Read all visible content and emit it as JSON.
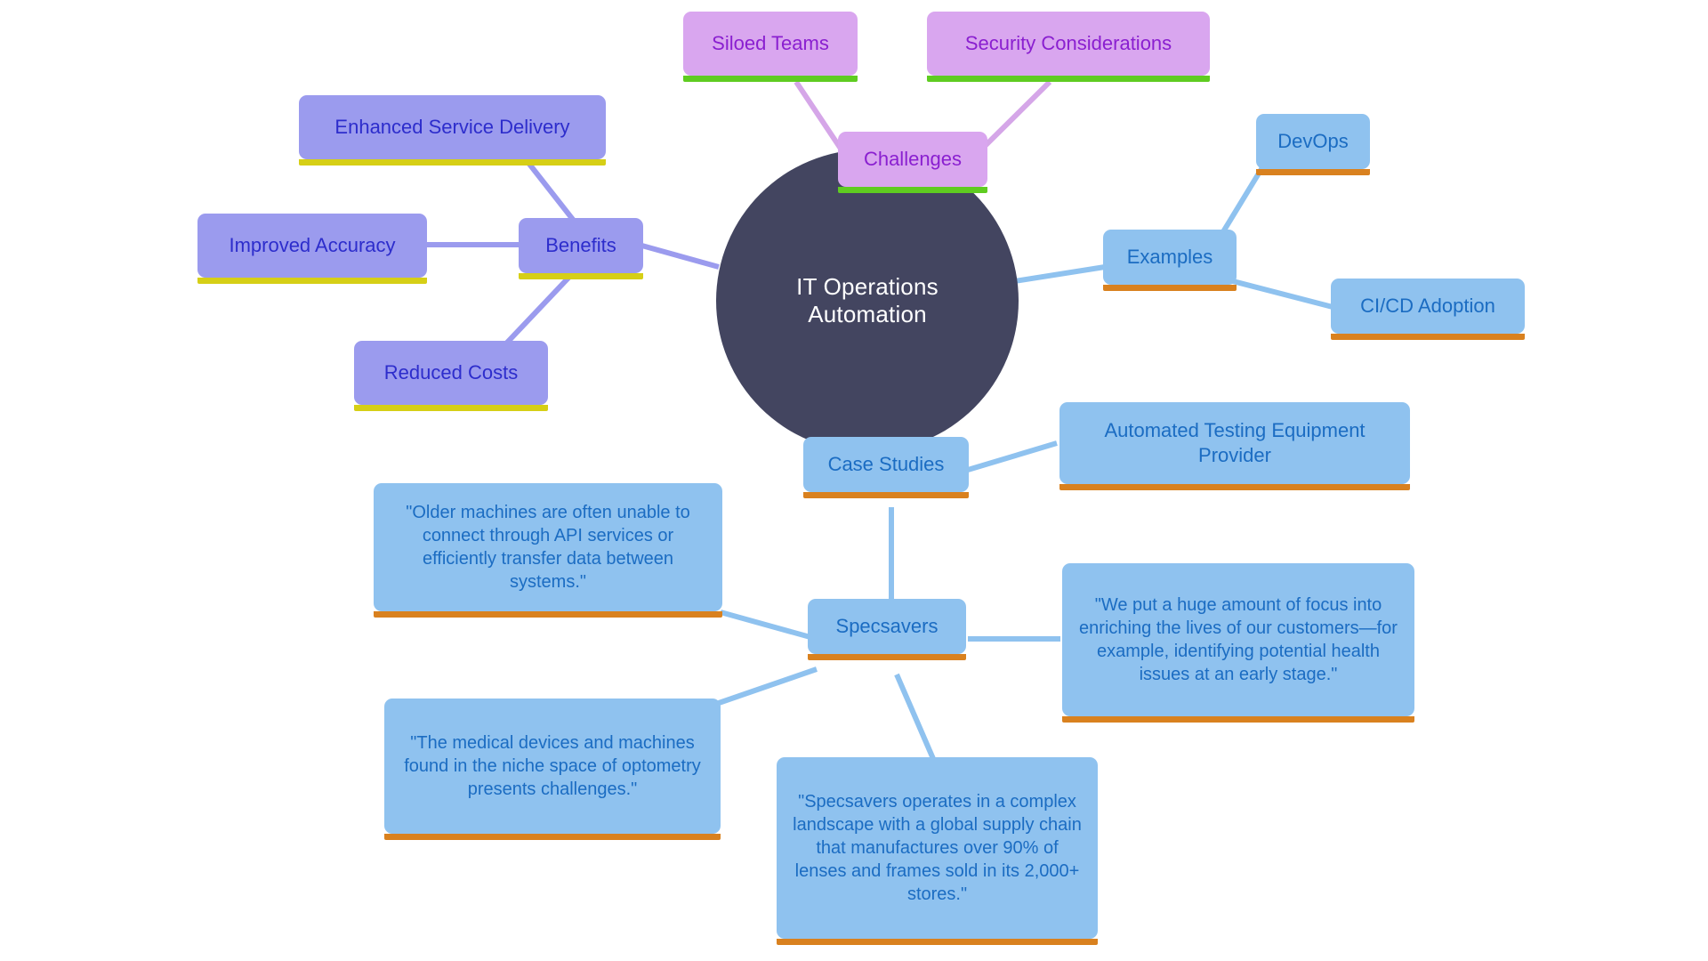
{
  "diagram": {
    "type": "mind-map",
    "background": "#ffffff",
    "root": {
      "label": "IT Operations Automation",
      "fill": "#434560",
      "text_color": "#ffffff"
    },
    "palettes": {
      "challenges": {
        "fill": "#d9a6ef",
        "text": "#8a1fd0",
        "underline": "#5fcc21",
        "edge": "#d5a6e8"
      },
      "benefits": {
        "fill": "#9b9bee",
        "text": "#2d2dcc",
        "underline": "#d6cf16",
        "edge": "#9b9bee"
      },
      "examples": {
        "fill": "#8fc2ef",
        "text": "#1b6cc2",
        "underline": "#d9811f",
        "edge": "#8fc2ef"
      }
    },
    "branches": [
      {
        "id": "challenges",
        "label": "Challenges",
        "children": [
          {
            "id": "siloed-teams",
            "label": "Siloed Teams"
          },
          {
            "id": "security-considerations",
            "label": "Security Considerations"
          }
        ]
      },
      {
        "id": "benefits",
        "label": "Benefits",
        "children": [
          {
            "id": "enhanced-service-delivery",
            "label": "Enhanced Service Delivery"
          },
          {
            "id": "improved-accuracy",
            "label": "Improved Accuracy"
          },
          {
            "id": "reduced-costs",
            "label": "Reduced Costs"
          }
        ]
      },
      {
        "id": "examples",
        "label": "Examples",
        "children": [
          {
            "id": "devops",
            "label": "DevOps"
          },
          {
            "id": "cicd-adoption",
            "label": "CI/CD Adoption"
          }
        ]
      },
      {
        "id": "case-studies",
        "label": "Case Studies",
        "children": [
          {
            "id": "automated-testing-equipment-provider",
            "label": "Automated Testing Equipment Provider"
          },
          {
            "id": "specsavers",
            "label": "Specsavers"
          }
        ]
      }
    ],
    "specsavers_quotes": [
      {
        "id": "quote-older-machines",
        "label": "\"Older machines are often unable to connect through API services or efficiently transfer data between systems.\""
      },
      {
        "id": "quote-enriching-lives",
        "label": "\"We put a huge amount of focus into enriching the lives of our customers—for example, identifying potential health issues at an early stage.\""
      },
      {
        "id": "quote-medical-devices",
        "label": "\"The medical devices and machines found in the niche space of optometry presents challenges.\""
      },
      {
        "id": "quote-complex-landscape",
        "label": "\"Specsavers operates in a complex landscape with a global supply chain that manufactures over 90% of lenses and frames sold in its 2,000+ stores.\""
      }
    ]
  }
}
